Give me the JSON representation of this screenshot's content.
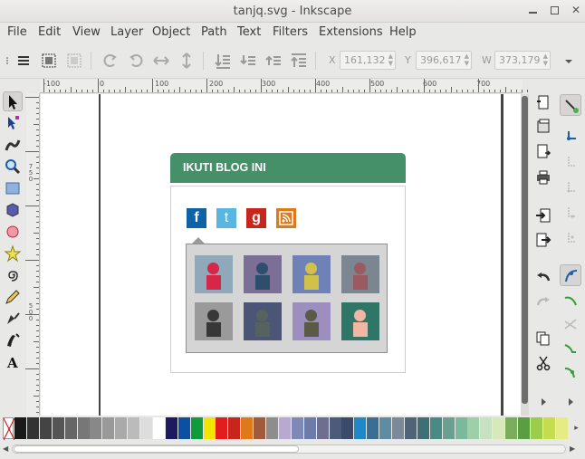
{
  "window": {
    "title": "tanjq.svg - Inkscape"
  },
  "menu": [
    "File",
    "Edit",
    "View",
    "Layer",
    "Object",
    "Path",
    "Text",
    "Filters",
    "Extensions",
    "Help"
  ],
  "coords": {
    "x_label": "X",
    "x_value": "161,132",
    "y_label": "Y",
    "y_value": "396,617",
    "w_label": "W",
    "w_value": "373,179"
  },
  "ruler": {
    "h_labels": [
      "-100",
      "0",
      "100",
      "200",
      "300",
      "400",
      "500",
      "600",
      "700"
    ],
    "v_labels": [
      "750",
      "500"
    ]
  },
  "widget": {
    "title": "IKUTI BLOG INI",
    "header_color": "#459069",
    "social": [
      {
        "name": "facebook",
        "glyph": "f",
        "color": "#0d63a8"
      },
      {
        "name": "twitter",
        "glyph": "t",
        "color": "#58b6e0"
      },
      {
        "name": "google",
        "glyph": "g",
        "color": "#c8251d"
      },
      {
        "name": "rss",
        "glyph": "",
        "color": "#e07919"
      }
    ],
    "avatars": [
      {
        "bg": "#8fa9bb",
        "head": "#d6264a",
        "body": "#d6264a"
      },
      {
        "bg": "#7b6f95",
        "head": "#2f4d6d",
        "body": "#2f4d6d"
      },
      {
        "bg": "#6f82b7",
        "head": "#d1c14a",
        "body": "#d1c14a"
      },
      {
        "bg": "#7c8691",
        "head": "#9a5a60",
        "body": "#9a5a60"
      },
      {
        "bg": "#9a9a9a",
        "head": "#383838",
        "body": "#383838"
      },
      {
        "bg": "#4b5677",
        "head": "#56625f",
        "body": "#56625f"
      },
      {
        "bg": "#9c8fbf",
        "head": "#5a5a46",
        "body": "#5a5a46"
      },
      {
        "bg": "#2f7666",
        "head": "#f1b7a4",
        "body": "#f1b7a4"
      }
    ]
  },
  "palette": [
    "#1a1a1a",
    "#333333",
    "#444444",
    "#555555",
    "#666666",
    "#777777",
    "#888888",
    "#999999",
    "#aaaaaa",
    "#bbbbbb",
    "#dddddd",
    "#ffffff",
    "#1e1a5e",
    "#0d4fa1",
    "#119b3c",
    "#f2e600",
    "#e31d1d",
    "#c8251d",
    "#e07919",
    "#a05a3c",
    "#8d8d8d",
    "#b8a9d1",
    "#7f89b5",
    "#6c7ba8",
    "#6e6e8f",
    "#4d5a7a",
    "#3b4a6b",
    "#1f88c9",
    "#3b6e93",
    "#5d8ca3",
    "#7a8a99",
    "#4f6577",
    "#3f6f74",
    "#4a8a85",
    "#6aa090",
    "#7ab99b",
    "#9fcfa8",
    "#c6e2c0",
    "#d9e8b8",
    "#7aae5c",
    "#5b9d41",
    "#9bcc4b",
    "#c5dc4e",
    "#e5ec84"
  ]
}
